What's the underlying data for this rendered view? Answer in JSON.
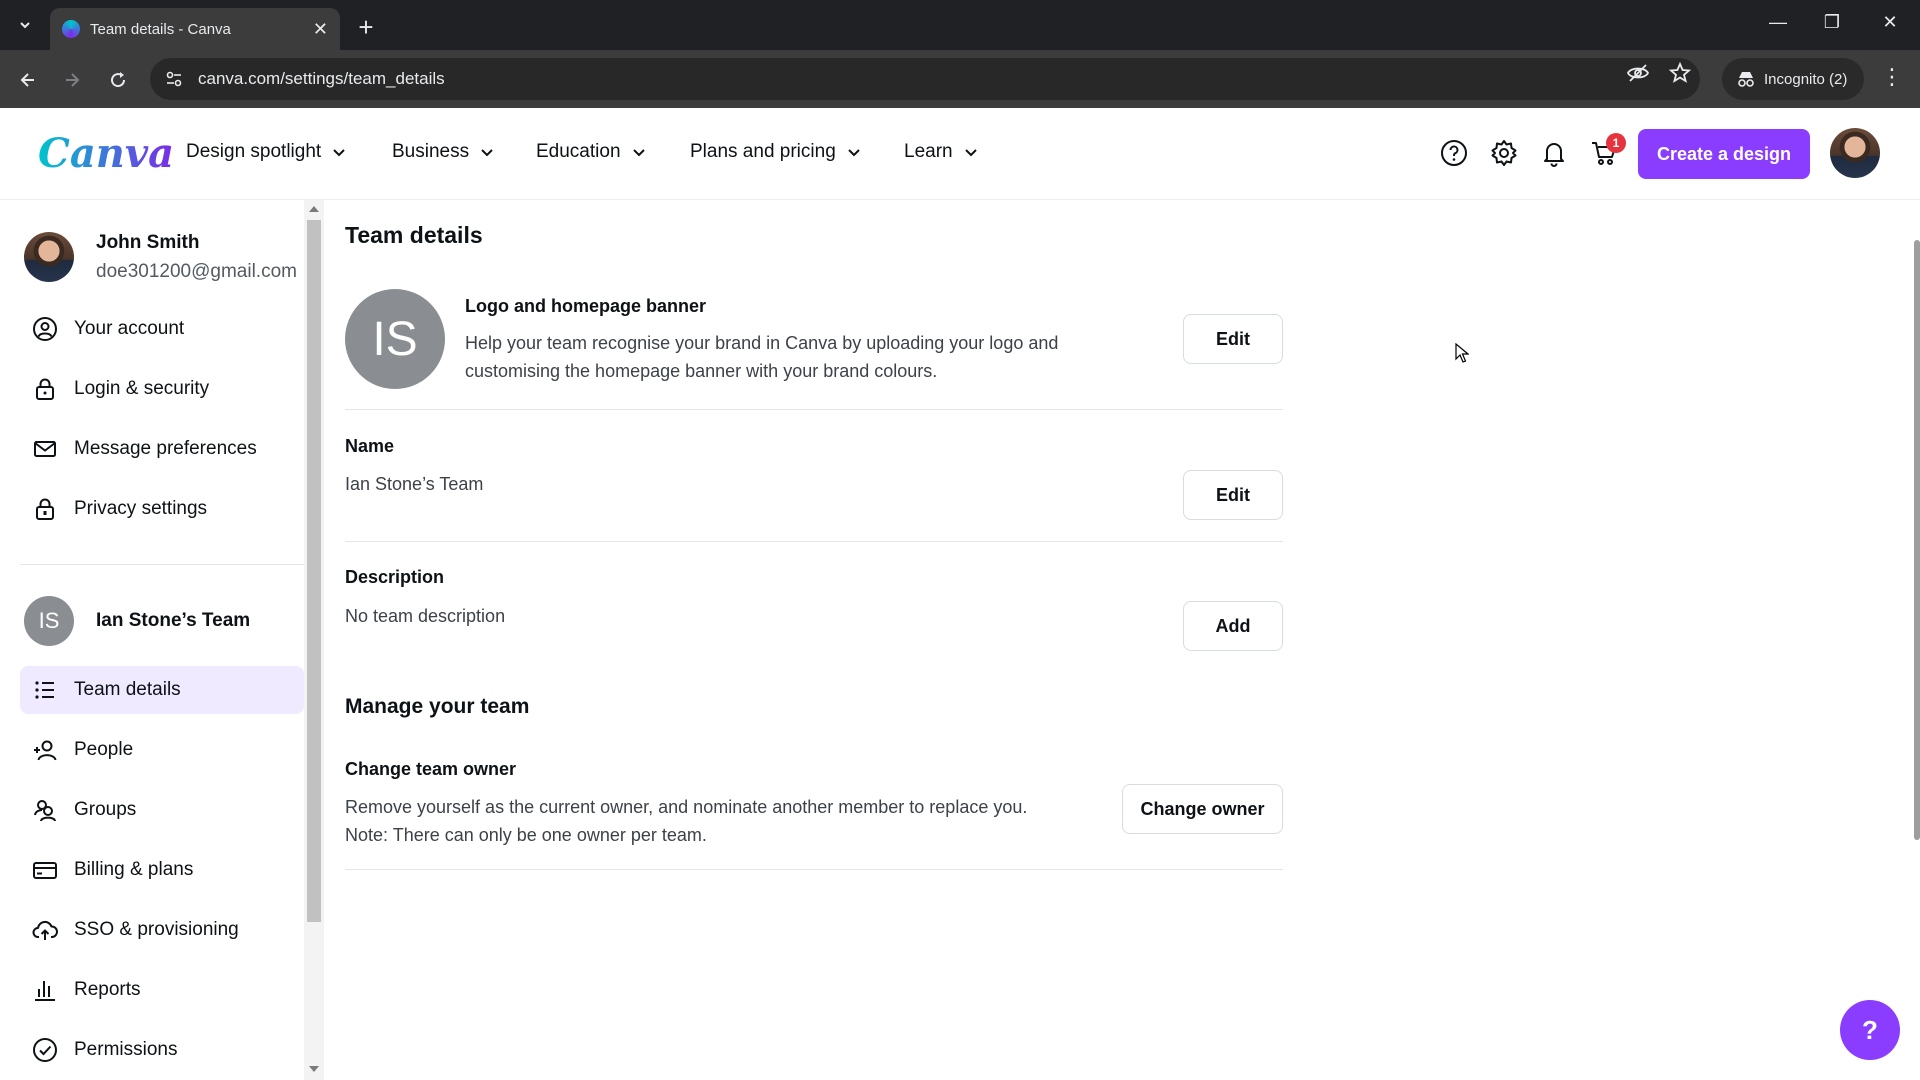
{
  "browser": {
    "tab_title": "Team details - Canva",
    "url": "canva.com/settings/team_details",
    "incognito_label": "Incognito (2)"
  },
  "header": {
    "logo": "Canva",
    "nav": [
      {
        "label": "Design spotlight"
      },
      {
        "label": "Business"
      },
      {
        "label": "Education"
      },
      {
        "label": "Plans and pricing"
      },
      {
        "label": "Learn"
      }
    ],
    "cart_count": "1",
    "create_label": "Create a design"
  },
  "sidebar": {
    "user": {
      "name": "John Smith",
      "email": "doe301200@gmail.com"
    },
    "account_items": [
      {
        "label": "Your account",
        "icon": "user-circle-icon"
      },
      {
        "label": "Login & security",
        "icon": "lock-icon"
      },
      {
        "label": "Message preferences",
        "icon": "envelope-icon"
      },
      {
        "label": "Privacy settings",
        "icon": "privacy-lock-icon"
      }
    ],
    "team": {
      "initials": "IS",
      "name": "Ian Stone’s Team"
    },
    "team_items": [
      {
        "label": "Team details",
        "icon": "list-icon",
        "active": true
      },
      {
        "label": "People",
        "icon": "add-person-icon"
      },
      {
        "label": "Groups",
        "icon": "groups-icon"
      },
      {
        "label": "Billing & plans",
        "icon": "credit-card-icon"
      },
      {
        "label": "SSO & provisioning",
        "icon": "cloud-upload-icon"
      },
      {
        "label": "Reports",
        "icon": "bar-chart-icon"
      },
      {
        "label": "Permissions",
        "icon": "check-circle-icon"
      }
    ]
  },
  "main": {
    "title": "Team details",
    "logo_section": {
      "avatar_initials": "IS",
      "label": "Logo and homepage banner",
      "description_line1": "Help your team recognise your brand in Canva by uploading your logo and",
      "description_line2": "customising the homepage banner with your brand colours.",
      "button": "Edit"
    },
    "name_section": {
      "label": "Name",
      "value": "Ian Stone’s Team",
      "button": "Edit"
    },
    "description_section": {
      "label": "Description",
      "value": "No team description",
      "button": "Add"
    },
    "manage": {
      "heading": "Manage your team",
      "change_owner_label": "Change team owner",
      "text_line1": "Remove yourself as the current owner, and nominate another member to replace you.",
      "text_line2": "Note: There can only be one owner per team.",
      "button": "Change owner"
    }
  },
  "help_fab": "?",
  "colors": {
    "accent": "#8b3dff",
    "active_bg": "#efeaff",
    "badge": "#e5343d"
  }
}
